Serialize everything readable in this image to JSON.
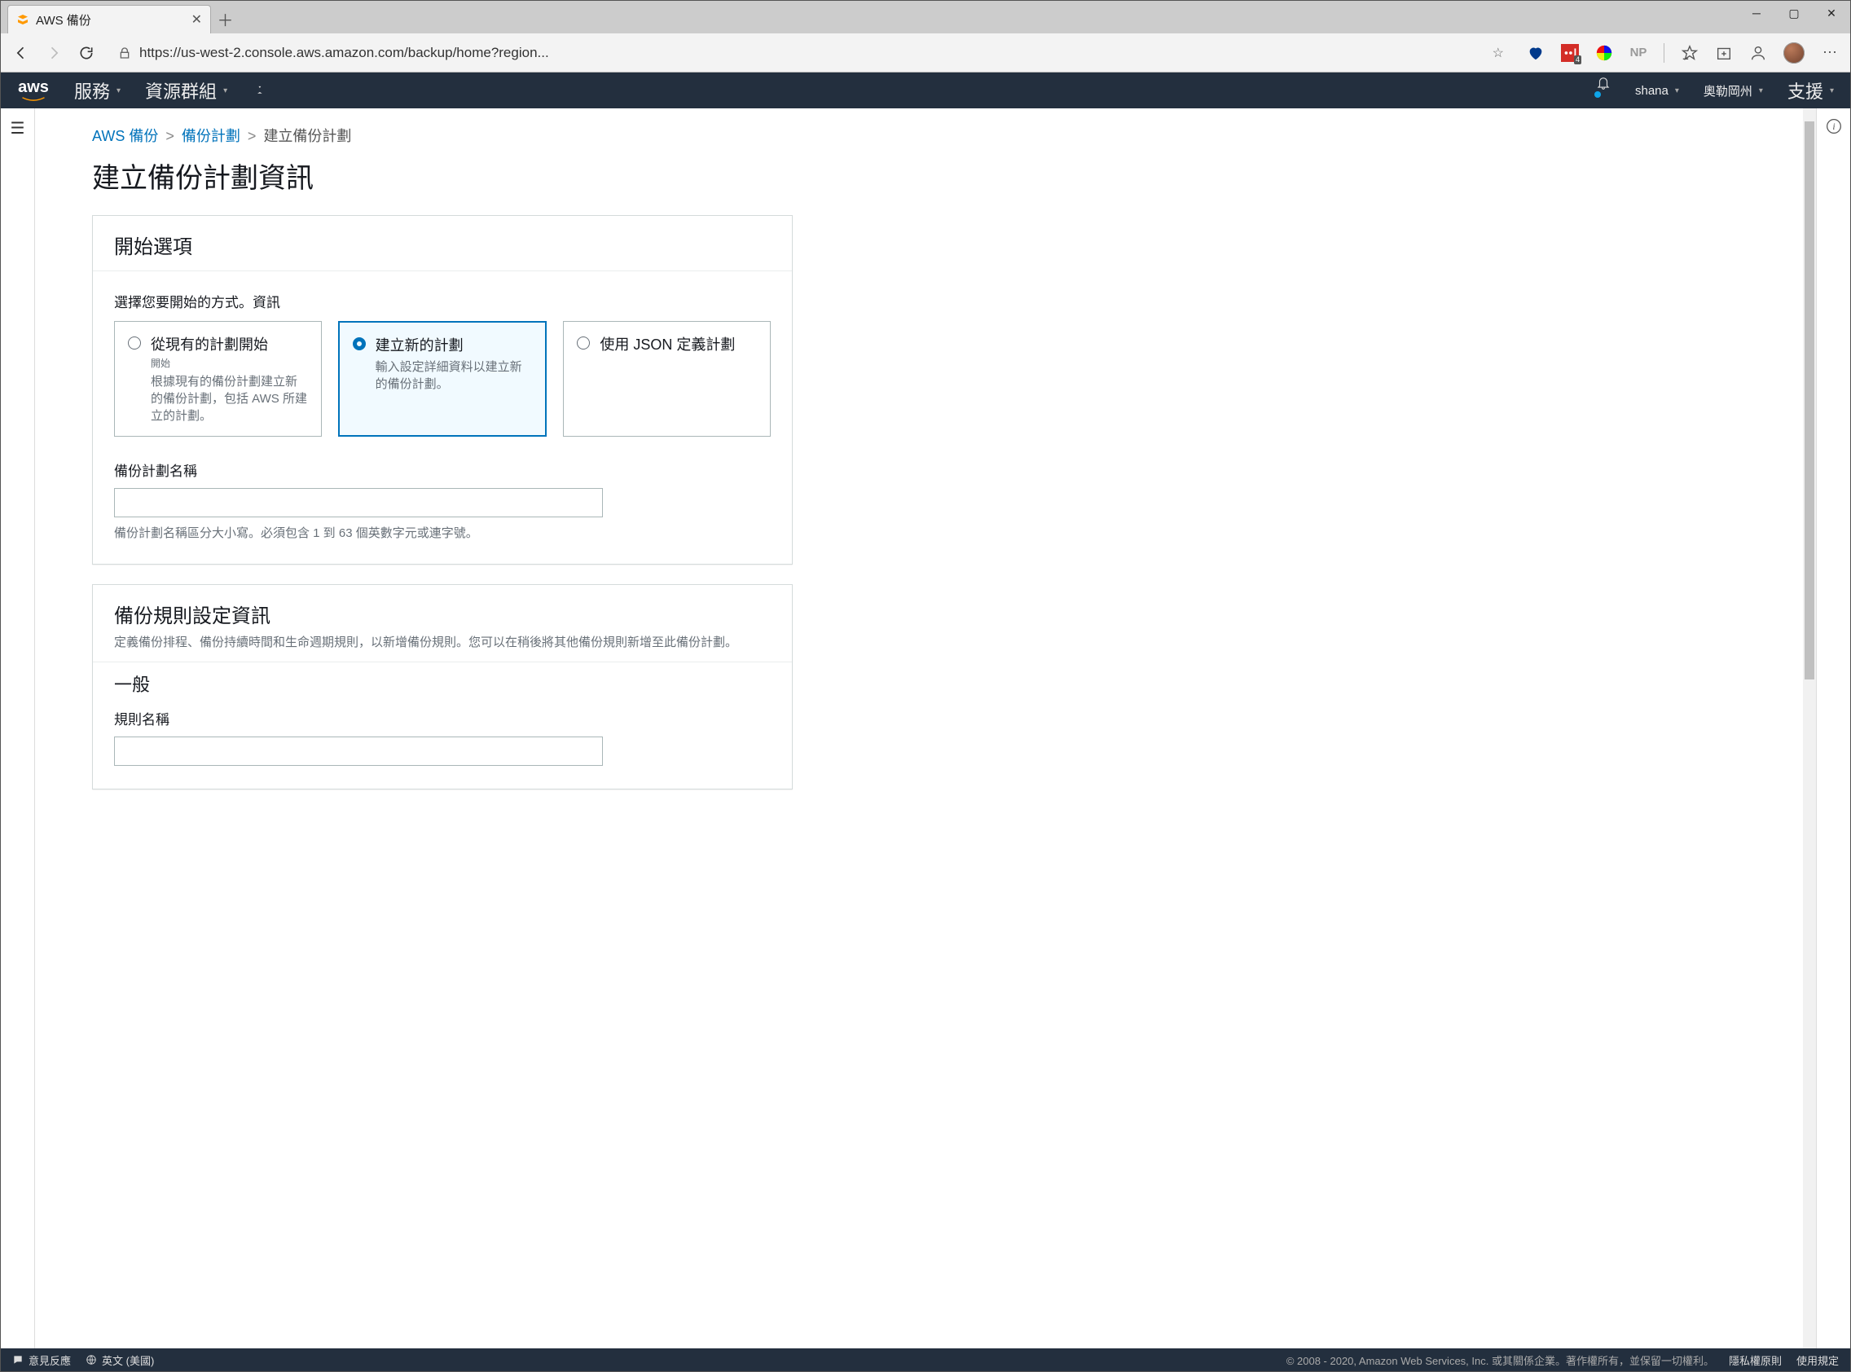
{
  "browser": {
    "tab_title": "AWS 備份",
    "url": "https://us-west-2.console.aws.amazon.com/backup/home?region..."
  },
  "aws_nav": {
    "services": "服務",
    "resource_groups": "資源群組",
    "user": "shana",
    "region": "奧勒岡州",
    "support": "支援"
  },
  "breadcrumb": {
    "items": [
      {
        "label": "AWS 備份",
        "link": true
      },
      {
        "label": "備份計劃",
        "link": true
      },
      {
        "label": "建立備份計劃",
        "link": false
      }
    ]
  },
  "page": {
    "title": "建立備份計劃資訊"
  },
  "start_panel": {
    "title": "開始選項",
    "instruction": "選擇您要開始的方式。資訊",
    "options": [
      {
        "title": "從現有的計劃開始",
        "sub": "開始",
        "desc": "根據現有的備份計劃建立新的備份計劃，包括 AWS 所建立的計劃。"
      },
      {
        "title": "建立新的計劃",
        "desc": "輸入設定詳細資料以建立新的備份計劃。"
      },
      {
        "title": "使用 JSON 定義計劃",
        "desc": ""
      }
    ],
    "plan_name_label": "備份計劃名稱",
    "plan_name_help": "備份計劃名稱區分大小寫。必須包含 1 到 63 個英數字元或連字號。"
  },
  "rules_panel": {
    "title": "備份規則設定資訊",
    "sub": "定義備份排程、備份持續時間和生命週期規則，以新增備份規則。您可以在稍後將其他備份規則新增至此備份計劃。",
    "section1": "一般",
    "rule_name_label": "規則名稱"
  },
  "footer": {
    "feedback": "意見反應",
    "language": "英文 (美國)",
    "copyright": "© 2008 - 2020, Amazon Web Services, Inc. 或其關係企業。著作權所有，並保留一切權利。",
    "privacy": "隱私權原則",
    "terms": "使用規定"
  },
  "ext_badge_count": "4"
}
